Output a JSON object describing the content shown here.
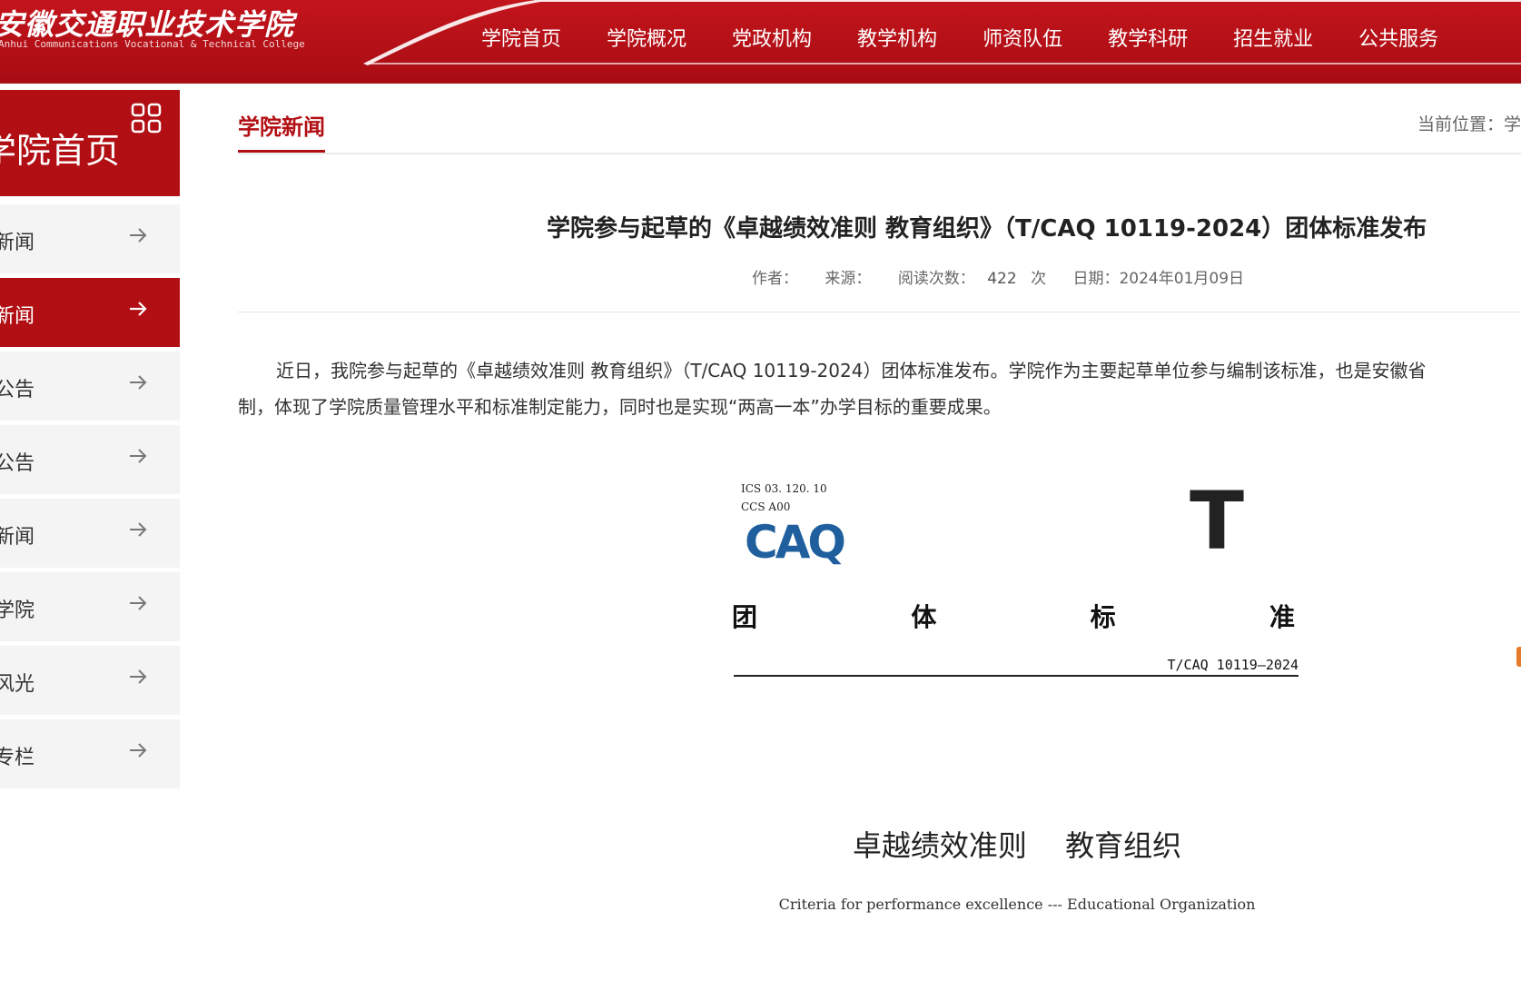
{
  "header": {
    "logo_cn": "安徽交通职业技术学院",
    "logo_en": "Anhui Communications Vocational & Technical College",
    "nav": [
      "学院首页",
      "学院概况",
      "党政机构",
      "教学机构",
      "师资队伍",
      "教学科研",
      "招生就业",
      "公共服务"
    ]
  },
  "sidebar": {
    "title": "学院首页",
    "items": [
      {
        "label": "新闻"
      },
      {
        "label": "新闻",
        "active": true
      },
      {
        "label": "公告"
      },
      {
        "label": "公告"
      },
      {
        "label": "新闻"
      },
      {
        "label": "学院"
      },
      {
        "label": "风光"
      },
      {
        "label": "专栏"
      }
    ]
  },
  "content": {
    "section_title": "学院新闻",
    "location_label": "当前位置：学",
    "article": {
      "title": "学院参与起草的《卓越绩效准则 教育组织》（T/CAQ 10119-2024）团体标准发布",
      "meta": {
        "author_label": "作者：",
        "source_label": "来源：",
        "views_label": "阅读次数：",
        "views_value": "422",
        "views_unit": "次",
        "date": "日期：2024年01月09日"
      },
      "paragraph_line1": "近日，我院参与起草的《卓越绩效准则 教育组织》（T/CAQ 10119-2024）团体标准发布。学院作为主要起草单位参与编制该标准，也是安徽省",
      "paragraph_line2": "制，体现了学院质量管理水平和标准制定能力，同时也是实现“两高一本”办学目标的重要成果。"
    },
    "cover": {
      "ics": "ICS   03. 120. 10",
      "ccs": "CCS   A00",
      "logo_text": "CAQ",
      "t_mark": "T",
      "std_chars": [
        "团",
        "体",
        "标",
        "准"
      ],
      "std_code": "T/CAQ 10119—2024",
      "title_left": "卓越绩效准则",
      "title_right": "教育组织",
      "subtitle": "Criteria for performance excellence --- Educational Organization"
    }
  },
  "colors": {
    "brand_red": "#b20f14",
    "caq_blue": "#1f5f9e",
    "caq_teal": "#1aa3b8"
  }
}
